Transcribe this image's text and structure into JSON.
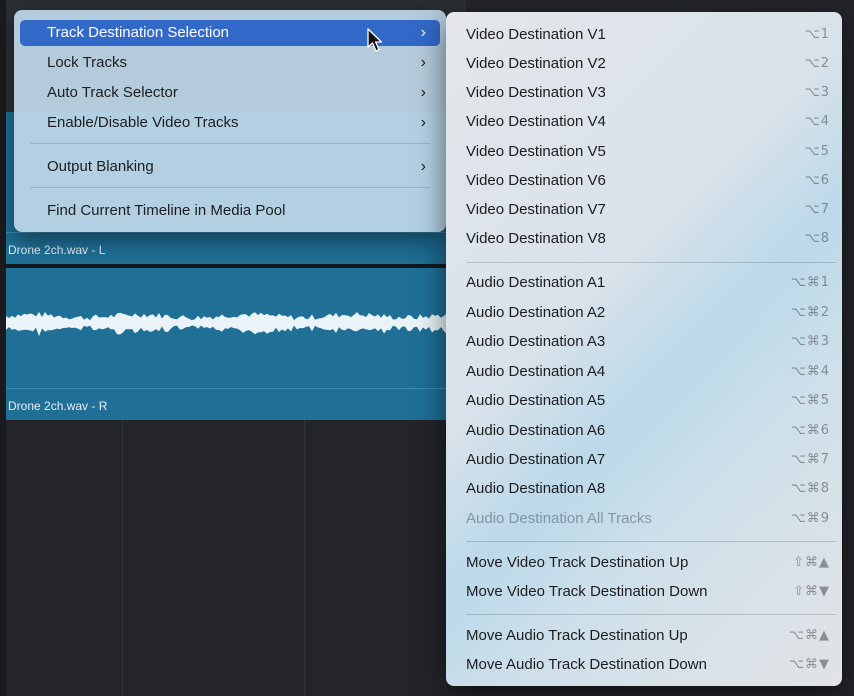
{
  "timeline": {
    "clip1_label": "Drone 2ch.wav - L",
    "clip2_label": "Drone 2ch.wav - R",
    "clip_color": "#1f6f96"
  },
  "menu_left": {
    "items": [
      {
        "label": "Track Destination Selection",
        "submenu": true,
        "selected": true
      },
      {
        "label": "Lock Tracks",
        "submenu": true
      },
      {
        "label": "Auto Track Selector",
        "submenu": true
      },
      {
        "label": "Enable/Disable Video Tracks",
        "submenu": true
      },
      {
        "label": "Output Blanking",
        "submenu": true
      },
      {
        "label": "Find Current Timeline in Media Pool",
        "submenu": false
      }
    ],
    "chevron": "›",
    "selection_color": "#3269c8"
  },
  "menu_right": {
    "video": [
      {
        "label": "Video Destination V1",
        "shortcut": "⌥1"
      },
      {
        "label": "Video Destination V2",
        "shortcut": "⌥2"
      },
      {
        "label": "Video Destination V3",
        "shortcut": "⌥3"
      },
      {
        "label": "Video Destination V4",
        "shortcut": "⌥4"
      },
      {
        "label": "Video Destination V5",
        "shortcut": "⌥5"
      },
      {
        "label": "Video Destination V6",
        "shortcut": "⌥6"
      },
      {
        "label": "Video Destination V7",
        "shortcut": "⌥7"
      },
      {
        "label": "Video Destination V8",
        "shortcut": "⌥8"
      }
    ],
    "audio": [
      {
        "label": "Audio Destination A1",
        "shortcut": "⌥⌘1"
      },
      {
        "label": "Audio Destination A2",
        "shortcut": "⌥⌘2"
      },
      {
        "label": "Audio Destination A3",
        "shortcut": "⌥⌘3"
      },
      {
        "label": "Audio Destination A4",
        "shortcut": "⌥⌘4"
      },
      {
        "label": "Audio Destination A5",
        "shortcut": "⌥⌘5"
      },
      {
        "label": "Audio Destination A6",
        "shortcut": "⌥⌘6"
      },
      {
        "label": "Audio Destination A7",
        "shortcut": "⌥⌘7"
      },
      {
        "label": "Audio Destination A8",
        "shortcut": "⌥⌘8"
      },
      {
        "label": "Audio Destination All Tracks",
        "shortcut": "⌥⌘9",
        "disabled": true
      }
    ],
    "move_video": [
      {
        "label": "Move Video Track Destination Up",
        "shortcut": "⇧⌘▲"
      },
      {
        "label": "Move Video Track Destination Down",
        "shortcut": "⇧⌘▼"
      }
    ],
    "move_audio": [
      {
        "label": "Move Audio Track Destination Up",
        "shortcut": "⌥⌘▲"
      },
      {
        "label": "Move Audio Track Destination Down",
        "shortcut": "⌥⌘▼"
      }
    ]
  },
  "icons": {
    "cursor": "mouse-pointer-icon",
    "submenu_arrow": "chevron-right-icon"
  }
}
